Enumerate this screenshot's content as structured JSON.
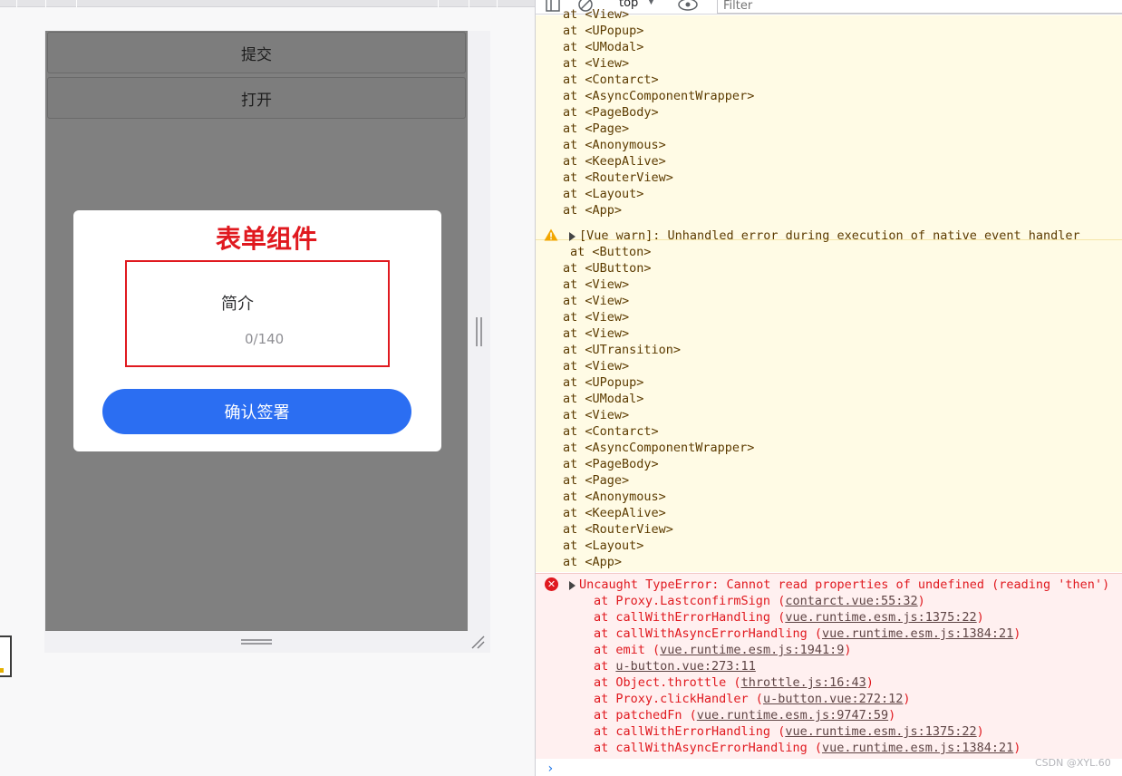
{
  "phone": {
    "submit_label": "提交",
    "open_label": "打开",
    "modal": {
      "title": "表单组件",
      "field_label": "简介",
      "counter": "0/140",
      "confirm_label": "确认签署"
    }
  },
  "devtools": {
    "context": "top",
    "filter_placeholder": "Filter",
    "colors": {
      "warn_bg": "#fffbe5",
      "error_bg": "#fff0f0",
      "error_text": "#e0191f",
      "warn_text": "#5c3b00"
    },
    "pre_trace": [
      "at <View>",
      "at <UPopup>",
      "at <UModal>",
      "at <View>",
      "at <Contarct>",
      "at <AsyncComponentWrapper>",
      "at <PageBody>",
      "at <Page>",
      "at <Anonymous>",
      "at <KeepAlive>",
      "at <RouterView>",
      "at <Layout>",
      "at <App>"
    ],
    "warning": {
      "message": "[Vue warn]: Unhandled error during execution of native event handler",
      "first_frame": "at <Button>",
      "trace": [
        "at <UButton>",
        "at <View>",
        "at <View>",
        "at <View>",
        "at <View>",
        "at <UTransition>",
        "at <View>",
        "at <UPopup>",
        "at <UModal>",
        "at <View>",
        "at <Contarct>",
        "at <AsyncComponentWrapper>",
        "at <PageBody>",
        "at <Page>",
        "at <Anonymous>",
        "at <KeepAlive>",
        "at <RouterView>",
        "at <Layout>",
        "at <App>"
      ]
    },
    "error": {
      "message": "Uncaught TypeError: Cannot read properties of undefined (reading 'then')",
      "stack": [
        {
          "fn": "at Proxy.LastconfirmSign (",
          "src": "contarct.vue:55:32",
          "end": ")"
        },
        {
          "fn": "at callWithErrorHandling (",
          "src": "vue.runtime.esm.js:1375:22",
          "end": ")"
        },
        {
          "fn": "at callWithAsyncErrorHandling (",
          "src": "vue.runtime.esm.js:1384:21",
          "end": ")"
        },
        {
          "fn": "at emit (",
          "src": "vue.runtime.esm.js:1941:9",
          "end": ")"
        },
        {
          "fn": "at ",
          "src": "u-button.vue:273:11",
          "end": ""
        },
        {
          "fn": "at Object.throttle (",
          "src": "throttle.js:16:43",
          "end": ")"
        },
        {
          "fn": "at Proxy.clickHandler (",
          "src": "u-button.vue:272:12",
          "end": ")"
        },
        {
          "fn": "at patchedFn (",
          "src": "vue.runtime.esm.js:9747:59",
          "end": ")"
        },
        {
          "fn": "at callWithErrorHandling (",
          "src": "vue.runtime.esm.js:1375:22",
          "end": ")"
        },
        {
          "fn": "at callWithAsyncErrorHandling (",
          "src": "vue.runtime.esm.js:1384:21",
          "end": ")"
        }
      ]
    },
    "prompt": "›"
  },
  "watermark": "CSDN @XYL.60"
}
